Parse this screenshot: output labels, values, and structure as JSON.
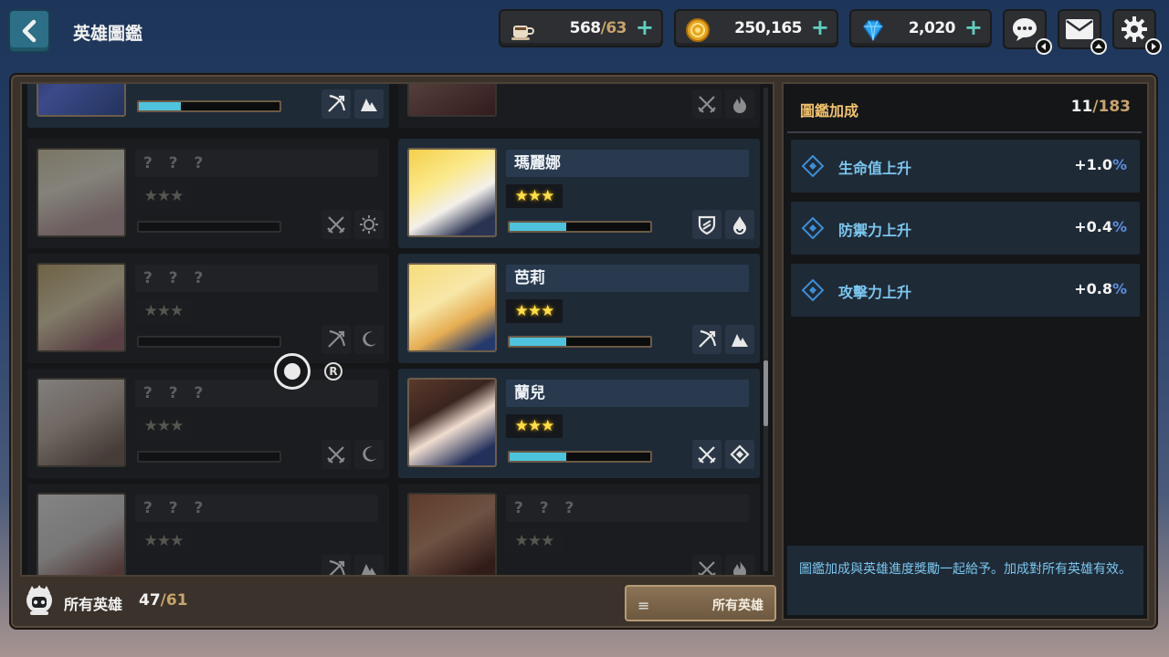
{
  "header": {
    "title": "英雄圖鑑",
    "stamina": {
      "value": "568",
      "max": "/63"
    },
    "gold": {
      "value": "250,165"
    },
    "gems": {
      "value": "2,020"
    }
  },
  "collection": {
    "label": "所有英雄",
    "count": "47",
    "max": "/61",
    "filter_label": "所有英雄"
  },
  "heroes_left": [
    {
      "name": "",
      "stars": "★★★",
      "progress": 0.3,
      "unlocked": true,
      "tags": [
        "bow-icon",
        "mountain-icon"
      ]
    },
    {
      "name": "? ? ?",
      "stars": "★★★",
      "progress": 0,
      "unlocked": false,
      "tags": [
        "crossed-swords-icon",
        "sun-icon"
      ]
    },
    {
      "name": "? ? ?",
      "stars": "★★★",
      "progress": 0,
      "unlocked": false,
      "tags": [
        "bow-icon",
        "moon-icon"
      ]
    },
    {
      "name": "? ? ?",
      "stars": "★★★",
      "progress": 0,
      "unlocked": false,
      "tags": [
        "crossed-swords-icon",
        "moon-icon"
      ]
    },
    {
      "name": "? ? ?",
      "stars": "★★★",
      "progress": 0,
      "unlocked": false,
      "tags": [
        "bow-icon",
        "mountain-icon"
      ]
    }
  ],
  "heroes_right": [
    {
      "name": "",
      "stars": "",
      "progress": 0,
      "unlocked": false,
      "tags": [
        "crossed-swords-icon",
        "flame-icon"
      ]
    },
    {
      "name": "瑪麗娜",
      "stars": "★★★",
      "progress": 0.4,
      "unlocked": true,
      "tags": [
        "shield-icon",
        "water-drop-icon"
      ]
    },
    {
      "name": "芭莉",
      "stars": "★★★",
      "progress": 0.4,
      "unlocked": true,
      "tags": [
        "bow-icon",
        "mountain-icon"
      ]
    },
    {
      "name": "蘭兒",
      "stars": "★★★",
      "progress": 0.4,
      "unlocked": true,
      "tags": [
        "crossed-swords-icon",
        "diamond-icon"
      ]
    },
    {
      "name": "? ? ?",
      "stars": "★★★",
      "progress": 0,
      "unlocked": false,
      "tags": [
        "crossed-swords-icon",
        "flame-icon"
      ]
    }
  ],
  "bonus": {
    "title": "圖鑑加成",
    "count": "11",
    "max": "/183",
    "stats": [
      {
        "label": "生命值上升",
        "value": "+1.0",
        "unit": "%"
      },
      {
        "label": "防禦力上升",
        "value": "+0.4",
        "unit": "%"
      },
      {
        "label": "攻擊力上升",
        "value": "+0.8",
        "unit": "%"
      }
    ],
    "note": "圖鑑加成與英雄進度獎勵一起給予。加成對所有英雄有效。"
  },
  "colors": {
    "accent": "#4ec3de",
    "gold_text": "#f2c26a",
    "star": "#ffe046"
  }
}
